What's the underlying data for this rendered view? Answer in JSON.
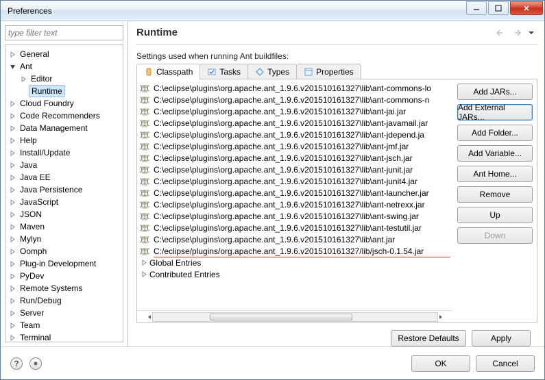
{
  "window": {
    "title": "Preferences"
  },
  "filter": {
    "placeholder": "type filter text"
  },
  "tree": {
    "items": [
      {
        "label": "General",
        "level": 1,
        "expanded": false,
        "hasChildren": true
      },
      {
        "label": "Ant",
        "level": 1,
        "expanded": true,
        "hasChildren": true
      },
      {
        "label": "Editor",
        "level": 2,
        "expanded": false,
        "hasChildren": true
      },
      {
        "label": "Runtime",
        "level": 2,
        "expanded": false,
        "hasChildren": false,
        "selected": true
      },
      {
        "label": "Cloud Foundry",
        "level": 1,
        "expanded": false,
        "hasChildren": true
      },
      {
        "label": "Code Recommenders",
        "level": 1,
        "expanded": false,
        "hasChildren": true
      },
      {
        "label": "Data Management",
        "level": 1,
        "expanded": false,
        "hasChildren": true
      },
      {
        "label": "Help",
        "level": 1,
        "expanded": false,
        "hasChildren": true
      },
      {
        "label": "Install/Update",
        "level": 1,
        "expanded": false,
        "hasChildren": true
      },
      {
        "label": "Java",
        "level": 1,
        "expanded": false,
        "hasChildren": true
      },
      {
        "label": "Java EE",
        "level": 1,
        "expanded": false,
        "hasChildren": true
      },
      {
        "label": "Java Persistence",
        "level": 1,
        "expanded": false,
        "hasChildren": true
      },
      {
        "label": "JavaScript",
        "level": 1,
        "expanded": false,
        "hasChildren": true
      },
      {
        "label": "JSON",
        "level": 1,
        "expanded": false,
        "hasChildren": true
      },
      {
        "label": "Maven",
        "level": 1,
        "expanded": false,
        "hasChildren": true
      },
      {
        "label": "Mylyn",
        "level": 1,
        "expanded": false,
        "hasChildren": true
      },
      {
        "label": "Oomph",
        "level": 1,
        "expanded": false,
        "hasChildren": true
      },
      {
        "label": "Plug-in Development",
        "level": 1,
        "expanded": false,
        "hasChildren": true
      },
      {
        "label": "PyDev",
        "level": 1,
        "expanded": false,
        "hasChildren": true
      },
      {
        "label": "Remote Systems",
        "level": 1,
        "expanded": false,
        "hasChildren": true
      },
      {
        "label": "Run/Debug",
        "level": 1,
        "expanded": false,
        "hasChildren": true
      },
      {
        "label": "Server",
        "level": 1,
        "expanded": false,
        "hasChildren": true
      },
      {
        "label": "Team",
        "level": 1,
        "expanded": false,
        "hasChildren": true
      },
      {
        "label": "Terminal",
        "level": 1,
        "expanded": false,
        "hasChildren": true
      }
    ]
  },
  "page": {
    "title": "Runtime",
    "subtitle": "Settings used when running Ant buildfiles:"
  },
  "tabs": [
    {
      "label": "Classpath",
      "active": true
    },
    {
      "label": "Tasks",
      "active": false
    },
    {
      "label": "Types",
      "active": false
    },
    {
      "label": "Properties",
      "active": false
    }
  ],
  "jars": [
    "C:\\eclipse\\plugins\\org.apache.ant_1.9.6.v201510161327\\lib\\ant-commons-lo",
    "C:\\eclipse\\plugins\\org.apache.ant_1.9.6.v201510161327\\lib\\ant-commons-n",
    "C:\\eclipse\\plugins\\org.apache.ant_1.9.6.v201510161327\\lib\\ant-jai.jar",
    "C:\\eclipse\\plugins\\org.apache.ant_1.9.6.v201510161327\\lib\\ant-javamail.jar",
    "C:\\eclipse\\plugins\\org.apache.ant_1.9.6.v201510161327\\lib\\ant-jdepend.ja",
    "C:\\eclipse\\plugins\\org.apache.ant_1.9.6.v201510161327\\lib\\ant-jmf.jar",
    "C:\\eclipse\\plugins\\org.apache.ant_1.9.6.v201510161327\\lib\\ant-jsch.jar",
    "C:\\eclipse\\plugins\\org.apache.ant_1.9.6.v201510161327\\lib\\ant-junit.jar",
    "C:\\eclipse\\plugins\\org.apache.ant_1.9.6.v201510161327\\lib\\ant-junit4.jar",
    "C:\\eclipse\\plugins\\org.apache.ant_1.9.6.v201510161327\\lib\\ant-launcher.jar",
    "C:\\eclipse\\plugins\\org.apache.ant_1.9.6.v201510161327\\lib\\ant-netrexx.jar",
    "C:\\eclipse\\plugins\\org.apache.ant_1.9.6.v201510161327\\lib\\ant-swing.jar",
    "C:\\eclipse\\plugins\\org.apache.ant_1.9.6.v201510161327\\lib\\ant-testutil.jar",
    "C:\\eclipse\\plugins\\org.apache.ant_1.9.6.v201510161327\\lib\\ant.jar",
    "C:/eclipse/plugins/org.apache.ant_1.9.6.v201510161327/lib/jsch-0.1.54.jar"
  ],
  "jar_groups": [
    "Global Entries",
    "Contributed Entries"
  ],
  "side_buttons": {
    "add_jars": "Add JARs...",
    "add_external": "Add External JARs...",
    "add_folder": "Add Folder...",
    "add_variable": "Add Variable...",
    "ant_home": "Ant Home...",
    "remove": "Remove",
    "up": "Up",
    "down": "Down"
  },
  "bottom": {
    "restore": "Restore Defaults",
    "apply": "Apply"
  },
  "dialog": {
    "ok": "OK",
    "cancel": "Cancel"
  }
}
